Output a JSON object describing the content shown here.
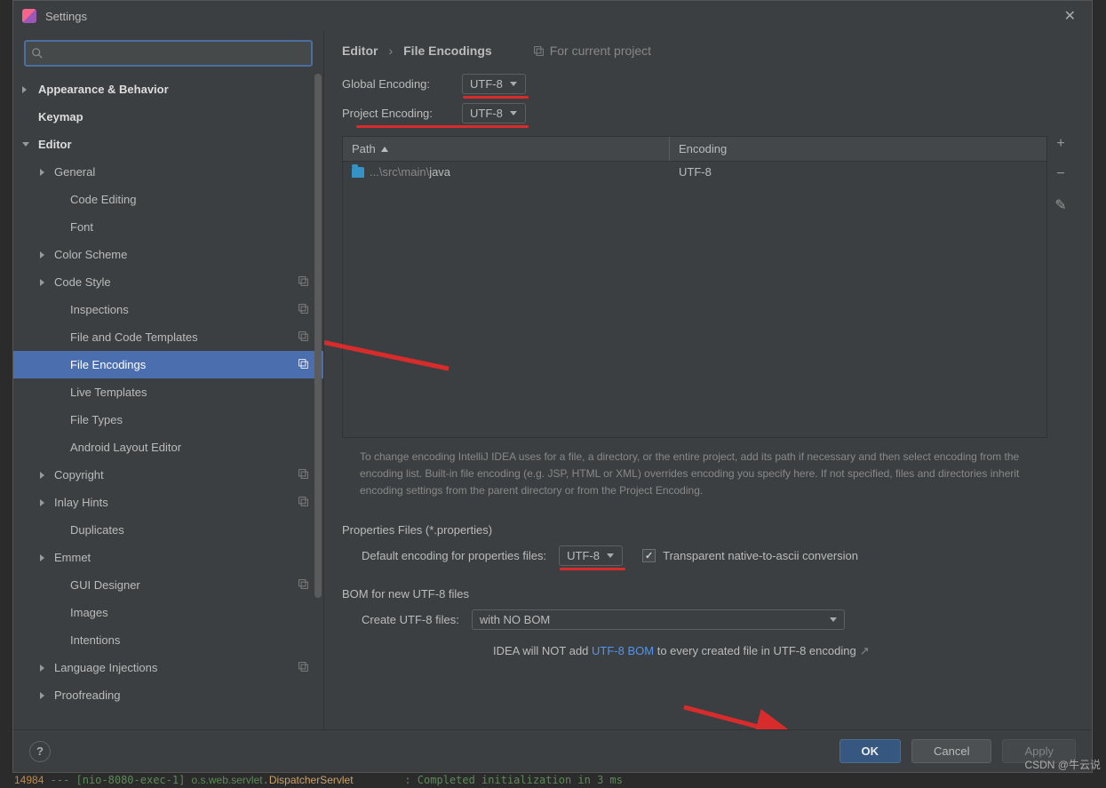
{
  "titlebar": {
    "title": "Settings"
  },
  "search": {
    "placeholder": ""
  },
  "tree": {
    "appearance": "Appearance & Behavior",
    "keymap": "Keymap",
    "editor": "Editor",
    "general": "General",
    "code_editing": "Code Editing",
    "font": "Font",
    "color_scheme": "Color Scheme",
    "code_style": "Code Style",
    "inspections": "Inspections",
    "file_templates": "File and Code Templates",
    "file_encodings": "File Encodings",
    "live_templates": "Live Templates",
    "file_types": "File Types",
    "android_layout": "Android Layout Editor",
    "copyright": "Copyright",
    "inlay_hints": "Inlay Hints",
    "duplicates": "Duplicates",
    "emmet": "Emmet",
    "gui_designer": "GUI Designer",
    "images": "Images",
    "intentions": "Intentions",
    "lang_injections": "Language Injections",
    "proofreading": "Proofreading"
  },
  "breadcrumb": {
    "root": "Editor",
    "leaf": "File Encodings",
    "scope": "For current project"
  },
  "global": {
    "label": "Global Encoding:",
    "value": "UTF-8"
  },
  "project": {
    "label": "Project Encoding:",
    "value": "UTF-8"
  },
  "table": {
    "col_path": "Path",
    "col_encoding": "Encoding",
    "row_path_dim": "...\\src\\main\\",
    "row_path": "java",
    "row_encoding": "UTF-8"
  },
  "hint": "To change encoding IntelliJ IDEA uses for a file, a directory, or the entire project, add its path if necessary and then select encoding from the encoding list. Built-in file encoding (e.g. JSP, HTML or XML) overrides encoding you specify here. If not specified, files and directories inherit encoding settings from the parent directory or from the Project Encoding.",
  "props": {
    "section": "Properties Files (*.properties)",
    "label": "Default encoding for properties files:",
    "value": "UTF-8",
    "checkbox_label": "Transparent native-to-ascii conversion"
  },
  "bom": {
    "section": "BOM for new UTF-8 files",
    "label": "Create UTF-8 files:",
    "value": "with NO BOM",
    "note_pre": "IDEA will NOT add ",
    "note_link": "UTF-8 BOM",
    "note_post": " to every created file in UTF-8 encoding"
  },
  "footer": {
    "ok": "OK",
    "cancel": "Cancel",
    "apply": "Apply"
  },
  "watermark": "CSDN @牛云说"
}
